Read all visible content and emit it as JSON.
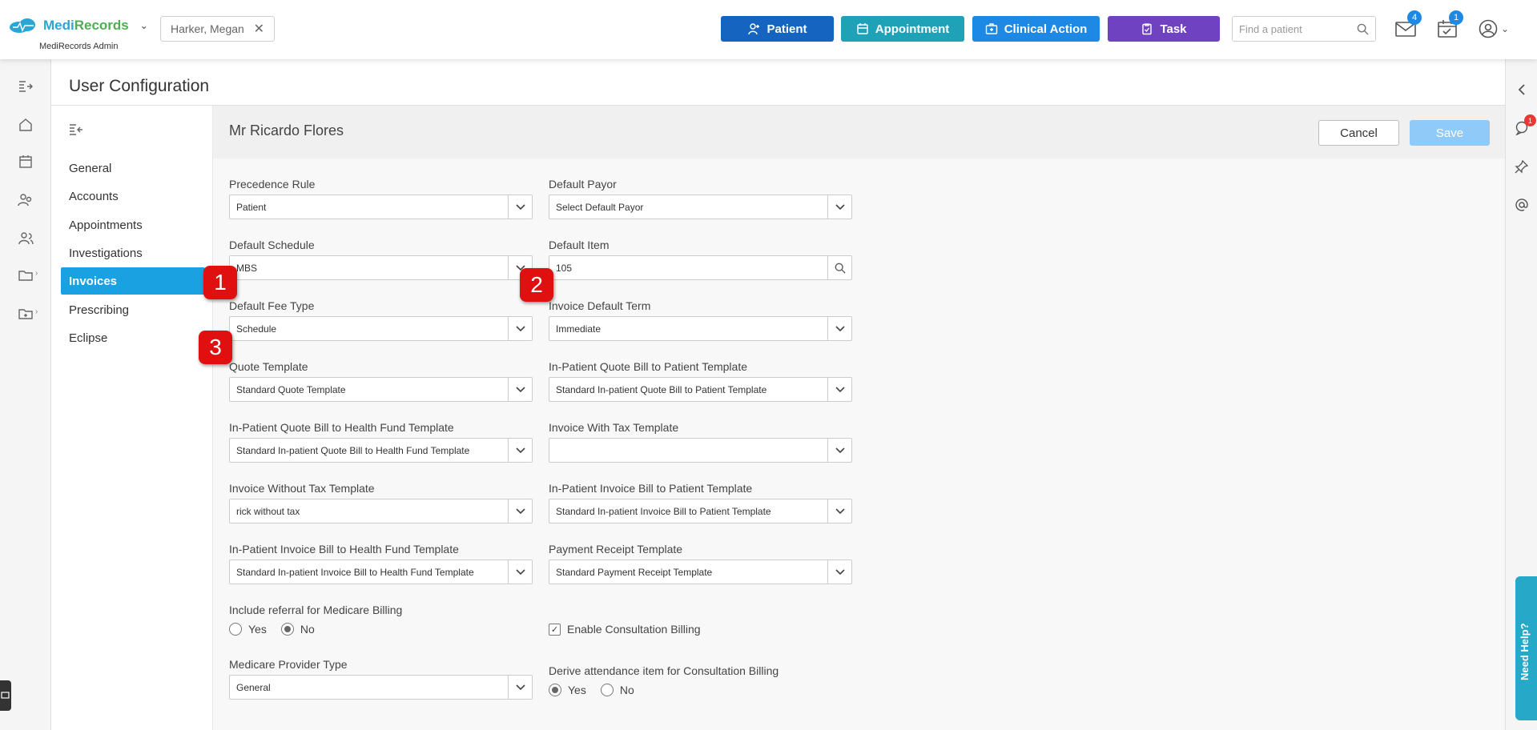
{
  "brand": {
    "name_part1": "Medi",
    "name_part2": "Records",
    "subtitle": "MediRecords Admin"
  },
  "current_patient": {
    "name": "Harker, Megan"
  },
  "actions": {
    "patient": "Patient",
    "appointment": "Appointment",
    "clinical_action": "Clinical Action",
    "task": "Task"
  },
  "search": {
    "placeholder": "Find a patient"
  },
  "notifications": {
    "mail_count": "4",
    "tasks_count": "1"
  },
  "page": {
    "title": "User Configuration"
  },
  "nav": {
    "items": [
      {
        "label": "General"
      },
      {
        "label": "Accounts"
      },
      {
        "label": "Appointments"
      },
      {
        "label": "Investigations"
      },
      {
        "label": "Invoices"
      },
      {
        "label": "Prescribing"
      },
      {
        "label": "Eclipse"
      }
    ],
    "active": "Invoices"
  },
  "form": {
    "user_name": "Mr Ricardo Flores",
    "cancel_label": "Cancel",
    "save_label": "Save",
    "precedence_rule": {
      "label": "Precedence Rule",
      "value": "Patient"
    },
    "default_payor": {
      "label": "Default Payor",
      "value": "Select Default Payor"
    },
    "default_schedule": {
      "label": "Default Schedule",
      "value": "MBS"
    },
    "default_item": {
      "label": "Default Item",
      "value": "105"
    },
    "default_fee_type": {
      "label": "Default Fee Type",
      "value": "Schedule"
    },
    "invoice_default_term": {
      "label": "Invoice Default Term",
      "value": "Immediate"
    },
    "quote_template": {
      "label": "Quote Template",
      "value": "Standard Quote Template"
    },
    "inpatient_quote_patient": {
      "label": "In-Patient Quote Bill to Patient Template",
      "value": "Standard In-patient Quote Bill to Patient Template"
    },
    "inpatient_quote_fund": {
      "label": "In-Patient Quote Bill to Health Fund Template",
      "value": "Standard In-patient Quote Bill to Health Fund Template"
    },
    "invoice_with_tax": {
      "label": "Invoice With Tax Template",
      "value": ""
    },
    "invoice_without_tax": {
      "label": "Invoice Without Tax Template",
      "value": "rick without tax"
    },
    "inpatient_invoice_patient": {
      "label": "In-Patient Invoice Bill to Patient Template",
      "value": "Standard In-patient Invoice Bill to Patient Template"
    },
    "inpatient_invoice_fund": {
      "label": "In-Patient Invoice Bill to Health Fund Template",
      "value": "Standard In-patient Invoice Bill to Health Fund Template"
    },
    "payment_receipt": {
      "label": "Payment Receipt Template",
      "value": "Standard Payment Receipt Template"
    },
    "include_referral": {
      "label": "Include referral for Medicare Billing",
      "yes": "Yes",
      "no": "No",
      "selected": "No"
    },
    "enable_consultation": {
      "label": "Enable Consultation Billing",
      "checked": true
    },
    "medicare_provider_type": {
      "label": "Medicare Provider Type",
      "value": "General"
    },
    "derive_attendance": {
      "label": "Derive attendance item for Consultation Billing",
      "yes": "Yes",
      "no": "No",
      "selected": "Yes"
    }
  },
  "callouts": [
    "1",
    "2",
    "3"
  ],
  "help": {
    "label": "Need Help?"
  },
  "colors": {
    "primary": "#1565c0",
    "teal": "#1fa2b8",
    "blue": "#1e88e5",
    "purple": "#6f42c1",
    "active_nav": "#1aa1e2",
    "callout": "#e01010"
  }
}
